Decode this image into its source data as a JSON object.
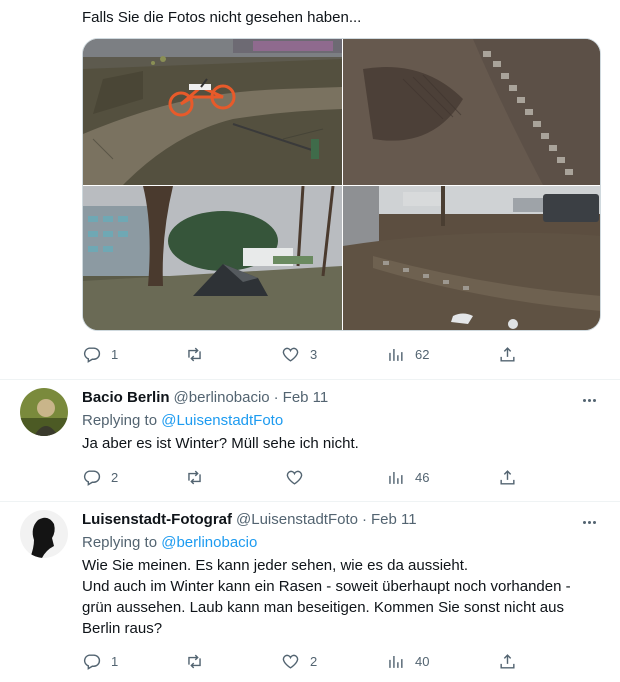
{
  "tweet1": {
    "text": "Falls Sie die Fotos nicht gesehen haben...",
    "photos": [
      "park path with rental bike",
      "muddy ground with cobblestone edge",
      "tent under trees",
      "muddy lawn near parked cars"
    ],
    "actions": {
      "replies": "1",
      "retweets": "",
      "likes": "3",
      "views": "62"
    }
  },
  "tweet2": {
    "name": "Bacio Berlin",
    "handle": "@berlinobacio",
    "sep": "·",
    "date": "Feb 11",
    "replying_prefix": "Replying to",
    "replying_to": "@LuisenstadtFoto",
    "text": "Ja aber es ist Winter? Müll sehe ich nicht.",
    "actions": {
      "replies": "2",
      "retweets": "",
      "likes": "",
      "views": "46"
    }
  },
  "tweet3": {
    "name": "Luisenstadt-Fotograf",
    "handle": "@LuisenstadtFoto",
    "sep": "·",
    "date": "Feb 11",
    "replying_prefix": "Replying to",
    "replying_to": "@berlinobacio",
    "lines": [
      "Wie Sie meinen. Es kann jeder sehen, wie es da aussieht.",
      "Und auch im Winter kann ein Rasen - soweit überhaupt noch vorhanden -",
      "grün aussehen. Laub kann man beseitigen. Kommen Sie sonst nicht aus",
      "Berlin raus?"
    ],
    "actions": {
      "replies": "1",
      "retweets": "",
      "likes": "2",
      "views": "40"
    }
  },
  "icons": {
    "reply": "reply-icon",
    "retweet": "retweet-icon",
    "like": "heart-icon",
    "views": "views-icon",
    "share": "share-icon",
    "more": "more-icon"
  },
  "colors": {
    "text": "#0f1419",
    "secondary": "#536471",
    "link": "#1d9bf0",
    "border": "#cfd9de"
  }
}
